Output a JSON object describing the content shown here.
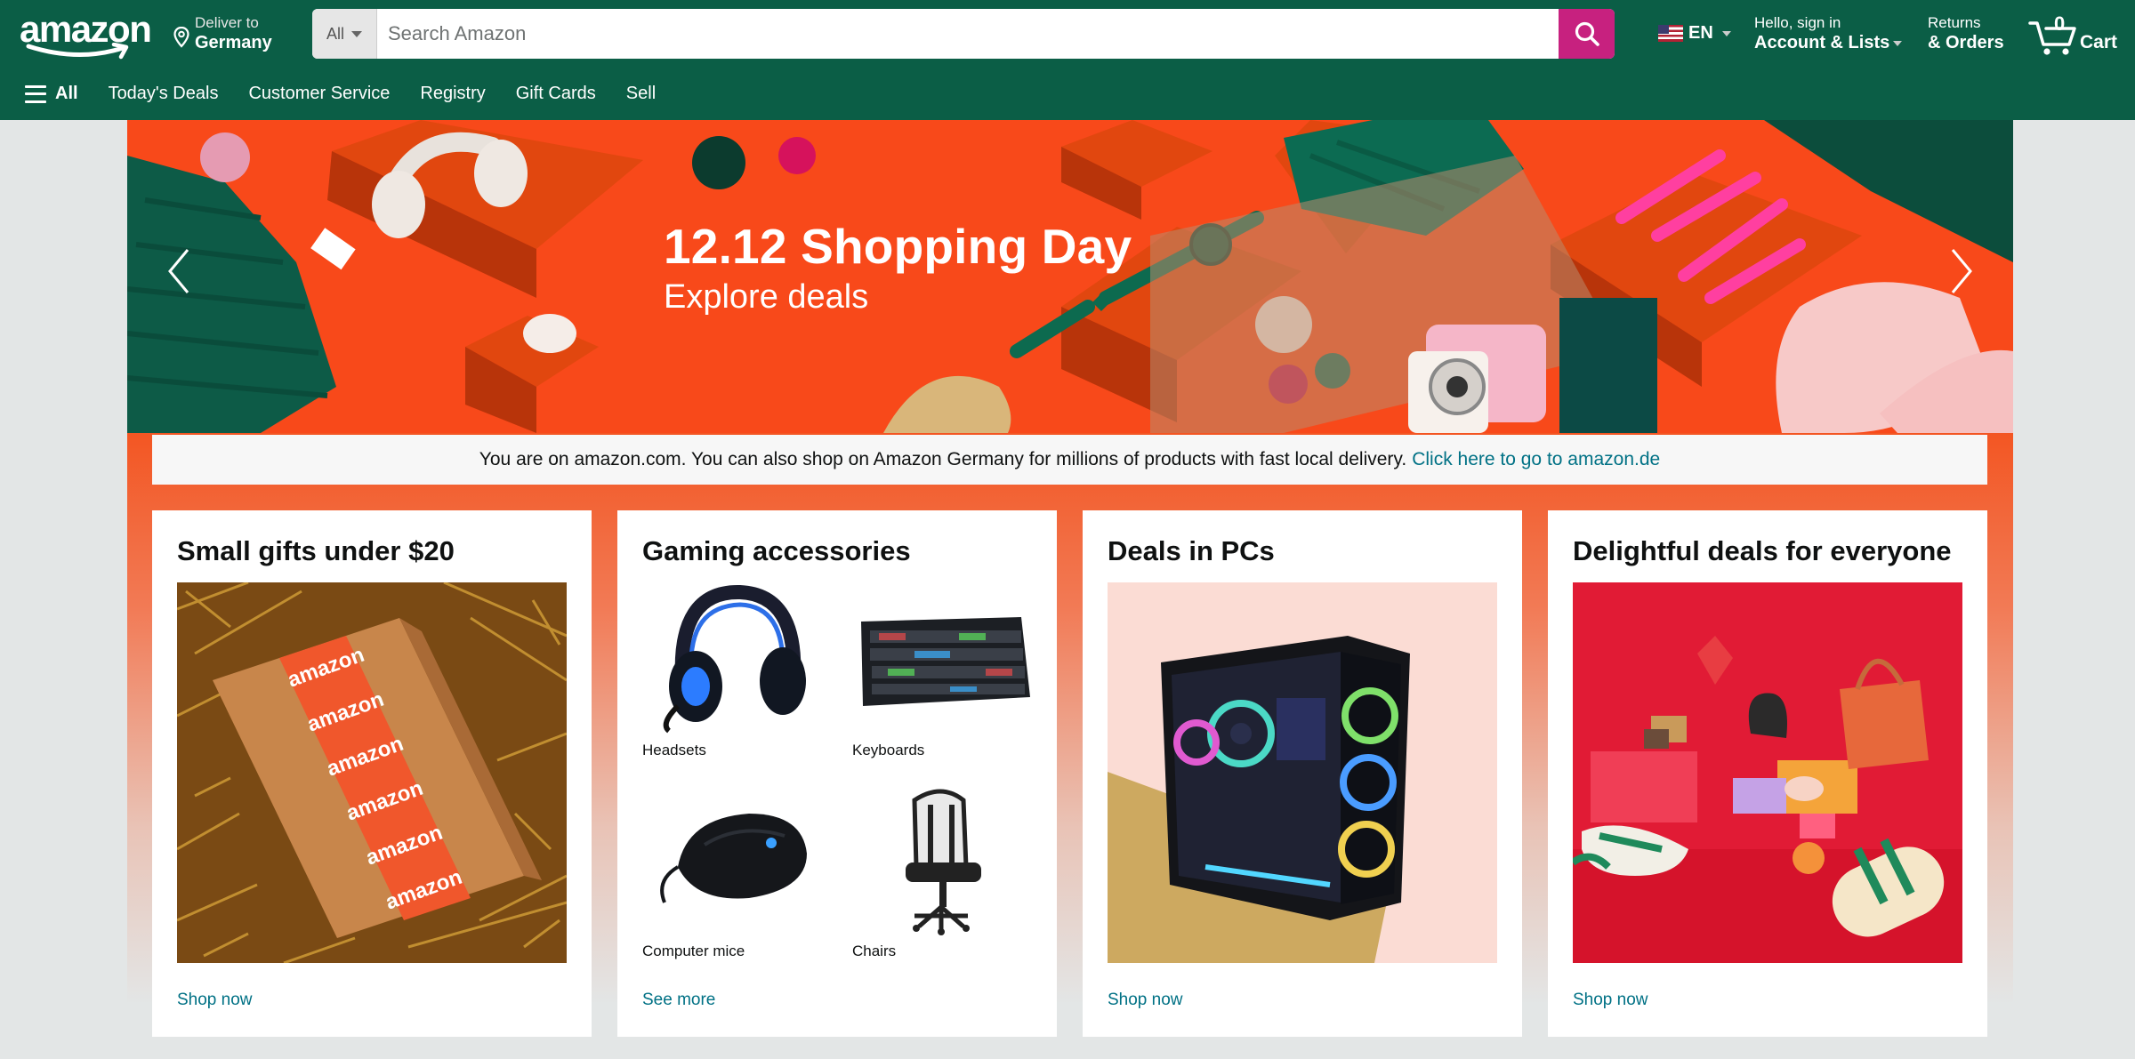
{
  "header": {
    "logo_text": "amazon",
    "deliver_line1": "Deliver to",
    "deliver_line2": "Germany",
    "search_category": "All",
    "search_placeholder": "Search Amazon",
    "language": "EN",
    "account_line1": "Hello, sign in",
    "account_line2": "Account & Lists",
    "returns_line1": "Returns",
    "returns_line2": "& Orders",
    "cart_count": "0",
    "cart_label": "Cart",
    "search_button_color": "#c7217f",
    "nav_color": "#0b5e46"
  },
  "subnav": {
    "all_label": "All",
    "items": [
      "Today's Deals",
      "Customer Service",
      "Registry",
      "Gift Cards",
      "Sell"
    ]
  },
  "hero": {
    "title": "12.12 Shopping Day",
    "subtitle": "Explore deals"
  },
  "notice": {
    "text": "You are on amazon.com. You can also shop on Amazon Germany for millions of products with fast local delivery.",
    "link": "Click here to go to amazon.de"
  },
  "cards": [
    {
      "title": "Small gifts under $20",
      "cta": "Shop now"
    },
    {
      "title": "Gaming accessories",
      "cta": "See more",
      "items": [
        "Headsets",
        "Keyboards",
        "Computer mice",
        "Chairs"
      ]
    },
    {
      "title": "Deals in PCs",
      "cta": "Shop now"
    },
    {
      "title": "Delightful deals for everyone",
      "cta": "Shop now"
    }
  ]
}
